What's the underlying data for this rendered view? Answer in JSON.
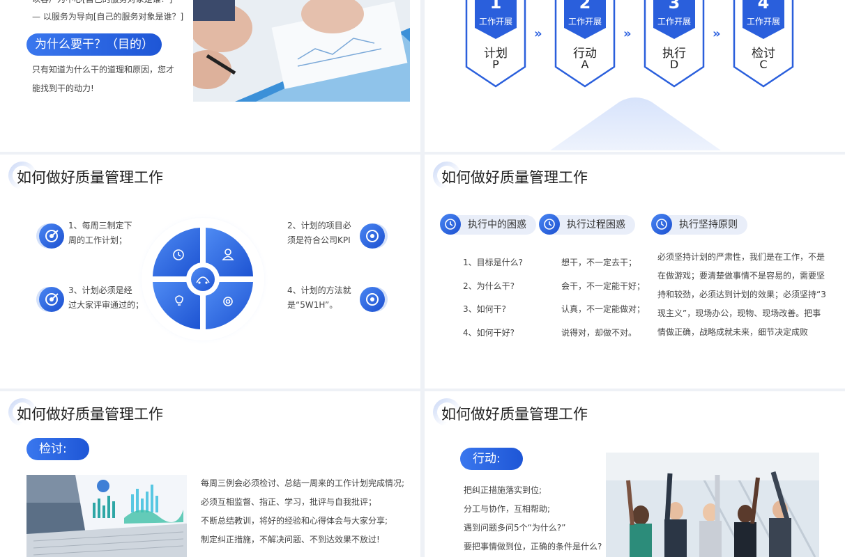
{
  "slide1": {
    "line_top": "以客户为中心[自己的服务对象是谁？]",
    "line_service": "— 以服务为导向[自己的服务对象是谁？]",
    "why_pill": "为什么要干？（目的）",
    "why_desc_1": "只有知道为什么干的道理和原因，您才",
    "why_desc_2": "能找到干的动力!"
  },
  "slide2": {
    "steps": [
      {
        "num": "1",
        "tag": "工作开展",
        "name": "计划",
        "letter": "P"
      },
      {
        "num": "2",
        "tag": "工作开展",
        "name": "行动",
        "letter": "A"
      },
      {
        "num": "3",
        "tag": "工作开展",
        "name": "执行",
        "letter": "D"
      },
      {
        "num": "4",
        "tag": "工作开展",
        "name": "检讨",
        "letter": "C"
      }
    ],
    "arrow": "»"
  },
  "slide3": {
    "title": "如何做好质量管理工作",
    "items": [
      {
        "line1": "1、每周三制定下",
        "line2": "周的工作计划；"
      },
      {
        "line1": "2、计划的项目必",
        "line2": "须是符合公司KPI"
      },
      {
        "line1": "3、计划必须是经",
        "line2": "过大家评审通过的；"
      },
      {
        "line1": "4、计划的方法就",
        "line2": "是“5W1H”。"
      }
    ]
  },
  "slide4": {
    "title": "如何做好质量管理工作",
    "tags": [
      "执行中的困惑",
      "执行过程困惑",
      "执行坚持原则"
    ],
    "questions": [
      "1、目标是什么?",
      "2、为什么干?",
      "3、如何干?",
      "4、如何干好?"
    ],
    "answers": [
      "想干，不一定去干；",
      "会干，不一定能干好；",
      "认真，不一定能做对；",
      "说得对，却做不对。"
    ],
    "principle_lines": [
      "必须坚持计划的严肃性，我们是在工作，不是",
      "在做游戏；要清楚做事情不是容易的，需要坚",
      "持和较劲，必须达到计划的效果；必须坚持“3",
      "现主义”，现场办公，现物、现场改善。把事",
      "情做正确，战略成就未来，细节决定成败"
    ]
  },
  "slide5": {
    "title": "如何做好质量管理工作",
    "pill": "检讨:",
    "lines": [
      "每周三例会必须检讨、总结一周来的工作计划完成情况;",
      "必须互相监督、指正、学习，批评与自我批评；",
      "不断总结教训，将好的经验和心得体会与大家分享;",
      "制定纠正措施，不解决问题、不到达效果不放过!"
    ]
  },
  "slide6": {
    "title": "如何做好质量管理工作",
    "pill": "行动:",
    "lines": [
      "把纠正措施落实到位;",
      "分工与协作，互相帮助;",
      "遇到问题多问5个“为什么?”",
      "要把事情做到位，正确的条件是什么?"
    ]
  },
  "colors": {
    "accent": "#2156d8",
    "accent_light": "#3a77ee",
    "bg": "#eef1f6"
  }
}
